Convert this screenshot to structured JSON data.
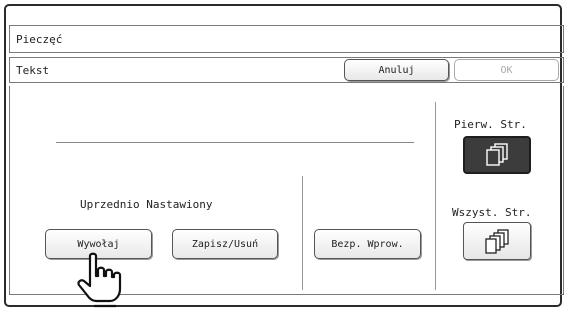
{
  "title": "Pieczęć",
  "tab": {
    "label": "Tekst",
    "cancel_label": "Anuluj",
    "ok_label": "OK"
  },
  "preset": {
    "heading": "Uprzednio Nastawiony",
    "recall_label": "Wywołaj",
    "store_delete_label": "Zapisz/Usuń"
  },
  "direct_entry_label": "Bezp. Wprow.",
  "pages": {
    "first_page_label": "Pierw. Str.",
    "all_pages_label": "Wszyst. Str.",
    "selected": "first_page"
  },
  "icons": {
    "first_page": "first-page-stack-icon",
    "all_pages": "all-pages-stack-icon",
    "pointer": "pointing-hand-icon"
  },
  "colors": {
    "frame": "#2b2b2b",
    "active_button": "#3c3c3c",
    "disabled_text": "#aaaaaa"
  }
}
